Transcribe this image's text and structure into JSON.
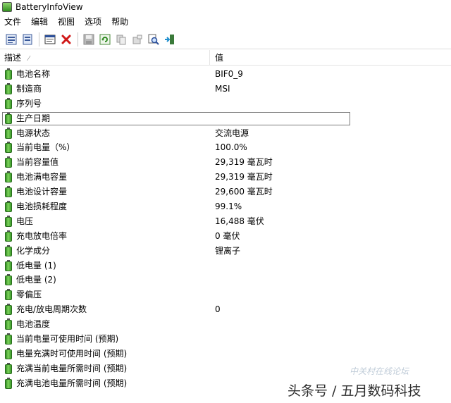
{
  "window": {
    "title": "BatteryInfoView"
  },
  "menu": [
    "文件",
    "编辑",
    "视图",
    "选项",
    "帮助"
  ],
  "toolbar": {
    "icons": [
      "html-report-all-icon",
      "html-report-selected-icon",
      "properties-icon",
      "delete-icon",
      "save-icon",
      "refresh-icon",
      "copy-icon",
      "options-icon",
      "find-icon",
      "exit-icon"
    ]
  },
  "columns": {
    "description": "描述",
    "value": "值"
  },
  "rows": [
    {
      "desc": "电池名称",
      "value": "BIF0_9"
    },
    {
      "desc": "制造商",
      "value": "MSI"
    },
    {
      "desc": "序列号",
      "value": ""
    },
    {
      "desc": "生产日期",
      "value": ""
    },
    {
      "desc": "电源状态",
      "value": "交流电源"
    },
    {
      "desc": "当前电量（%）",
      "value": "100.0%"
    },
    {
      "desc": "当前容量值",
      "value": "29,319 毫瓦时"
    },
    {
      "desc": "电池满电容量",
      "value": "29,319 毫瓦时"
    },
    {
      "desc": "电池设计容量",
      "value": "29,600 毫瓦时"
    },
    {
      "desc": "电池损耗程度",
      "value": "99.1%"
    },
    {
      "desc": "电压",
      "value": "16,488 毫伏"
    },
    {
      "desc": "充电放电倍率",
      "value": "0 毫伏"
    },
    {
      "desc": "化学成分",
      "value": "锂离子"
    },
    {
      "desc": "低电量 (1)",
      "value": ""
    },
    {
      "desc": "低电量 (2)",
      "value": ""
    },
    {
      "desc": "零偏压",
      "value": ""
    },
    {
      "desc": "充电/放电周期次数",
      "value": "0"
    },
    {
      "desc": "电池温度",
      "value": ""
    },
    {
      "desc": "当前电量可使用时间 (预期)",
      "value": ""
    },
    {
      "desc": "电量充满时可使用时间 (预期)",
      "value": ""
    },
    {
      "desc": "充满当前电量所需时间 (预期)",
      "value": ""
    },
    {
      "desc": "充满电池电量所需时间 (预期)",
      "value": ""
    }
  ],
  "watermark": {
    "logo_text": "中关村在线论坛",
    "text": "头条号 / 五月数码科技"
  }
}
